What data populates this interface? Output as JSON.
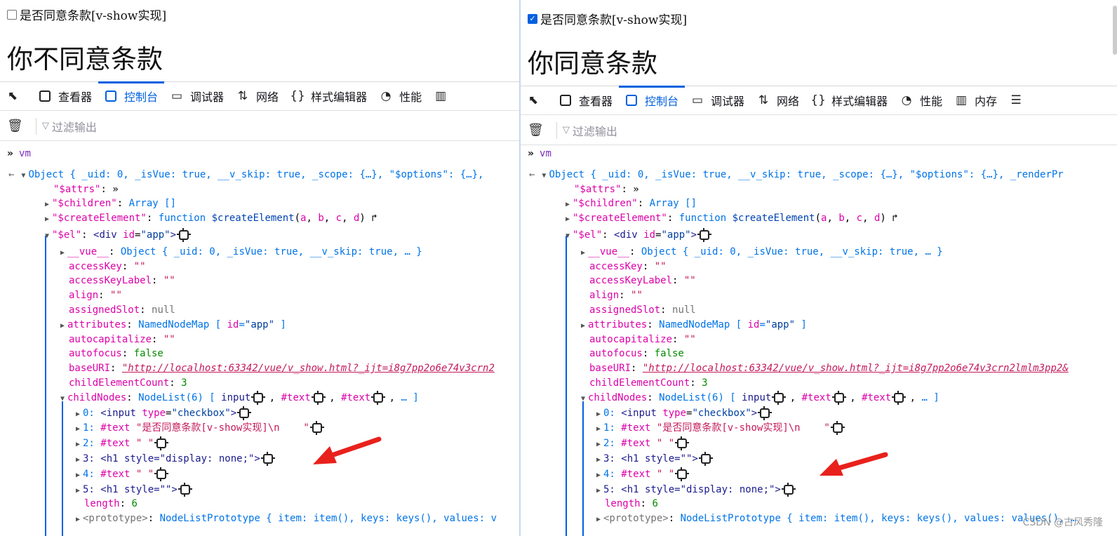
{
  "left": {
    "checkbox_label": "是否同意条款[v-show实现]",
    "heading": "你不同意条款",
    "tools": [
      {
        "label": "查看器",
        "icon": "inspector-icon"
      },
      {
        "label": "控制台",
        "icon": "console-icon",
        "active": true
      },
      {
        "label": "调试器",
        "icon": "debugger-icon"
      },
      {
        "label": "网络",
        "icon": "network-icon"
      },
      {
        "label": "样式编辑器",
        "icon": "style-editor-icon"
      },
      {
        "label": "性能",
        "icon": "performance-icon"
      }
    ],
    "filter_placeholder": "过滤输出",
    "prompt": "vm",
    "object_line": "Object { _uid: 0, _isVue: true, __v_skip: true, _scope: {…}, \"$options\": {…},",
    "child3": "3: <h1 style=\"display: none;\">",
    "child5": "5: <h1 style=\"\">",
    "url": "\"http://localhost:63342/vue/v_show.html?_ijt=i8g7pp2o6e74v3crn2"
  },
  "right": {
    "checkbox_label": "是否同意条款[v-show实现]",
    "heading": "你同意条款",
    "tools": [
      {
        "label": "查看器",
        "icon": "inspector-icon"
      },
      {
        "label": "控制台",
        "icon": "console-icon",
        "active": true
      },
      {
        "label": "调试器",
        "icon": "debugger-icon"
      },
      {
        "label": "网络",
        "icon": "network-icon"
      },
      {
        "label": "样式编辑器",
        "icon": "style-editor-icon"
      },
      {
        "label": "性能",
        "icon": "performance-icon"
      },
      {
        "label": "内存",
        "icon": "memory-icon"
      }
    ],
    "filter_placeholder": "过滤输出",
    "prompt": "vm",
    "object_line": "Object { _uid: 0, _isVue: true, __v_skip: true, _scope: {…}, \"$options\": {…}, _renderPr",
    "child3": "3: <h1 style=\"\">",
    "child5": "5: <h1 style=\"display: none;\">",
    "url": "\"http://localhost:63342/vue/v_show.html?_ijt=i8g7pp2o6e74v3crn2lmlm3pp2&"
  },
  "watermark": "CSDN @古风秀隆"
}
